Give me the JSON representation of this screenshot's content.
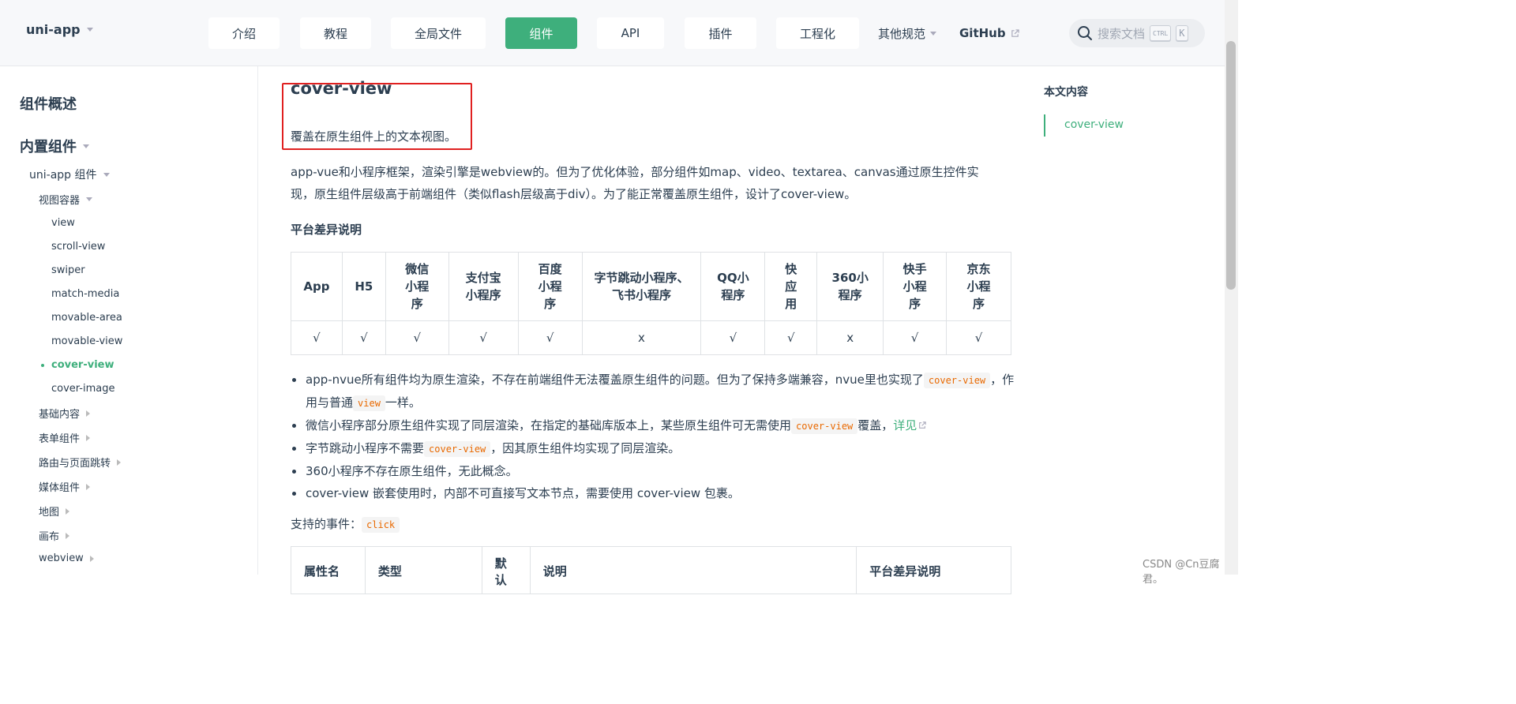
{
  "navbar": {
    "brand": "uni-app",
    "items": [
      {
        "label": "介绍"
      },
      {
        "label": "教程"
      },
      {
        "label": "全局文件"
      },
      {
        "label": "组件",
        "active": true
      },
      {
        "label": "API"
      },
      {
        "label": "插件"
      },
      {
        "label": "工程化"
      }
    ],
    "more_label": "其他规范",
    "github_label": "GitHub",
    "search_placeholder": "搜索文档",
    "kbd_ctrl": "CTRL",
    "kbd_k": "K"
  },
  "sidebar": {
    "overview": "组件概述",
    "builtin": "内置组件",
    "uniapp_group": "uni-app 组件",
    "view_container": "视图容器",
    "items": [
      "view",
      "scroll-view",
      "swiper",
      "match-media",
      "movable-area",
      "movable-view",
      "cover-view",
      "cover-image"
    ],
    "active_item": "cover-view",
    "groups": [
      "基础内容",
      "表单组件",
      "路由与页面跳转",
      "媒体组件",
      "地图",
      "画布",
      "webview"
    ]
  },
  "content": {
    "title": "cover-view",
    "subtitle": "覆盖在原生组件上的文本视图。",
    "intro_line1": "app-vue和小程序框架，渲染引擎是webview的。但为了优化体验，部分组件如map、video、textarea、canvas通过原生控件实",
    "intro_line2": "现，原生组件层级高于前端组件（类似flash层级高于div）。为了能正常覆盖原生组件，设计了cover-view。",
    "platform_heading": "平台差异说明",
    "platform_table": {
      "headers": [
        "App",
        "H5",
        "微信小程序",
        "支付宝小程序",
        "百度小程序",
        "字节跳动小程序、飞书小程序",
        "QQ小程序",
        "快应用",
        "360小程序",
        "快手小程序",
        "京东小程序"
      ],
      "values": [
        "√",
        "√",
        "√",
        "√",
        "√",
        "x",
        "√",
        "√",
        "x",
        "√",
        "√"
      ]
    },
    "bullets": {
      "b1_pre": "app-nvue所有组件均为原生渲染，不存在前端组件无法覆盖原生组件的问题。但为了保持多端兼容，nvue里也实现了",
      "b1_code1": "cover-view",
      "b1_mid": "，作用与普通",
      "b1_code2": "view",
      "b1_post": "一样。",
      "b2_pre": "微信小程序部分原生组件实现了同层渲染，在指定的基础库版本上，某些原生组件可无需使用",
      "b2_code": "cover-view",
      "b2_mid": "覆盖，",
      "b2_link": "详见",
      "b3_pre": "字节跳动小程序不需要",
      "b3_code": "cover-view",
      "b3_post": "，因其原生组件均实现了同层渲染。",
      "b4": "360小程序不存在原生组件，无此概念。",
      "b5": "cover-view 嵌套使用时，内部不可直接写文本节点，需要使用 cover-view 包裹。"
    },
    "events_label": "支持的事件：",
    "events_code": "click",
    "props_headers": [
      "属性名",
      "类型",
      "默认",
      "说明",
      "平台差异说明"
    ]
  },
  "toc": {
    "title": "本文内容",
    "items": [
      "cover-view"
    ]
  },
  "watermark": "CSDN @Cn豆腐君。",
  "colors": {
    "accent": "#3eaf7c",
    "code": "#e96900",
    "highlight_box": "#e02020"
  }
}
